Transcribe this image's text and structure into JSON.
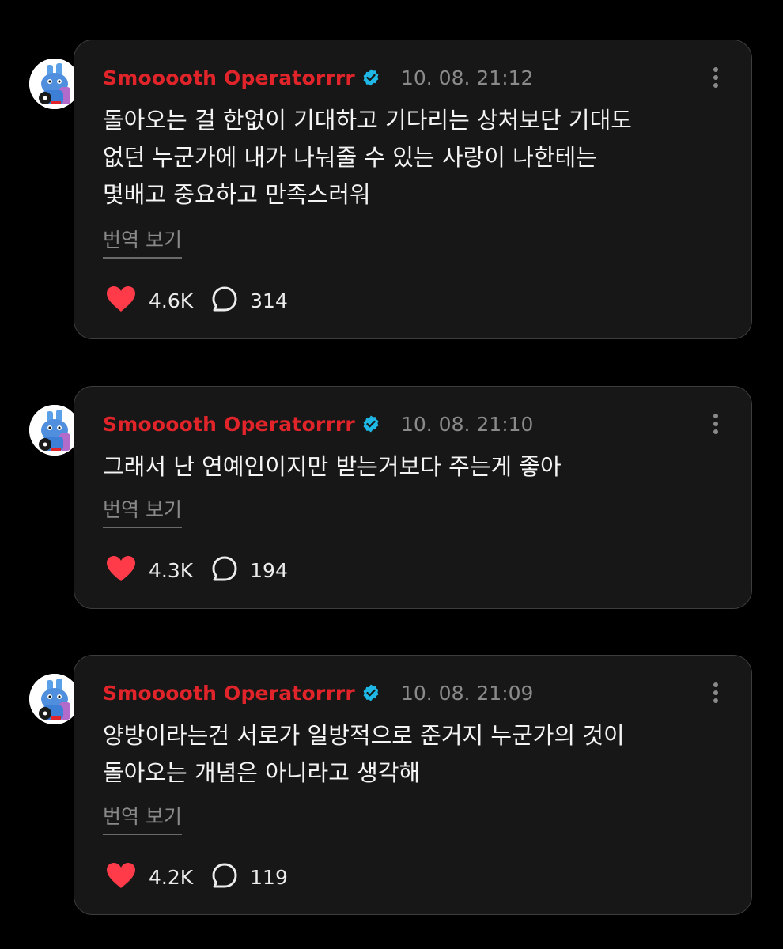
{
  "colors": {
    "background": "#000000",
    "card": "#171717",
    "card_border": "#3d3d3d",
    "username": "#e0242a",
    "verified": "#1fb8e6",
    "like": "#ff3b4a",
    "muted": "#8a8a8a"
  },
  "icons": {
    "verified": "verified-badge-icon",
    "more": "more-vertical-icon",
    "like": "heart-icon",
    "reply": "speech-bubble-icon"
  },
  "posts": [
    {
      "username": "Smooooth Operatorrrr",
      "timestamp": "10. 08. 21:12",
      "lines": [
        "돌아오는 걸 한없이 기대하고 기다리는 상처보단 기대도",
        "없던 누군가에 내가 나눠줄 수 있는 사랑이 나한테는",
        "몇배고 중요하고 만족스러워"
      ],
      "translate_label": "번역 보기",
      "likes": "4.6K",
      "replies": "314"
    },
    {
      "username": "Smooooth Operatorrrr",
      "timestamp": "10. 08. 21:10",
      "lines": [
        "그래서 난 연예인이지만 받는거보다 주는게 좋아"
      ],
      "translate_label": "번역 보기",
      "likes": "4.3K",
      "replies": "194"
    },
    {
      "username": "Smooooth Operatorrrr",
      "timestamp": "10. 08. 21:09",
      "lines": [
        "양방이라는건 서로가 일방적으로 준거지 누군가의 것이",
        "돌아오는 개념은 아니라고 생각해"
      ],
      "translate_label": "번역 보기",
      "likes": "4.2K",
      "replies": "119"
    }
  ]
}
